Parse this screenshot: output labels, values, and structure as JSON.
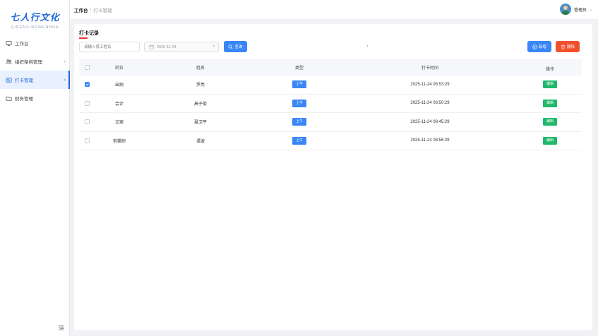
{
  "logo": {
    "title": "七人行文化",
    "subtitle": "QIRENXINGWENHUA"
  },
  "sidebar": {
    "items": [
      {
        "label": "工作台",
        "icon": "monitor-icon",
        "has_arrow": false,
        "active": false
      },
      {
        "label": "组织架构管理",
        "icon": "team-icon",
        "has_arrow": true,
        "active": false
      },
      {
        "label": "打卡管理",
        "icon": "card-icon",
        "has_arrow": true,
        "active": true
      },
      {
        "label": "财务管理",
        "icon": "folder-icon",
        "has_arrow": false,
        "active": false
      }
    ]
  },
  "breadcrumb": {
    "home": "工作台",
    "separator": "/",
    "current": "打卡管理"
  },
  "user": {
    "name": "管理员",
    "caret": "⌄"
  },
  "page": {
    "title": "打卡记录"
  },
  "filters": {
    "search_placeholder": "请输入员工姓名",
    "date_value": "2025-11-24",
    "date_arrow": "›",
    "query_label": "查询",
    "pager_arrow": "›"
  },
  "actions": {
    "add_label": "新增",
    "delete_label": "删除"
  },
  "table": {
    "headers": {
      "position": "岗位",
      "name": "姓名",
      "type": "类型",
      "time": "打卡时间",
      "op": "操作"
    },
    "rows": [
      {
        "position": "出纳",
        "name": "罗亮",
        "type": "上午",
        "time": "2025-11-24 08:53:29",
        "op": "编辑",
        "checked": true
      },
      {
        "position": "会计",
        "name": "高子俊",
        "type": "上午",
        "time": "2025-11-24 08:50:29",
        "op": "编辑",
        "checked": false
      },
      {
        "position": "文案",
        "name": "聂卫平",
        "type": "上午",
        "time": "2025-11-24 08:45:29",
        "op": "编辑",
        "checked": false
      },
      {
        "position": "剪辑师",
        "name": "谭波",
        "type": "上午",
        "time": "2025-11-24 08:56:29",
        "op": "编辑",
        "checked": false
      }
    ]
  },
  "colors": {
    "primary": "#3a86f6",
    "danger": "#f0502e",
    "success": "#1fb86a",
    "brand": "#1f67d8"
  }
}
